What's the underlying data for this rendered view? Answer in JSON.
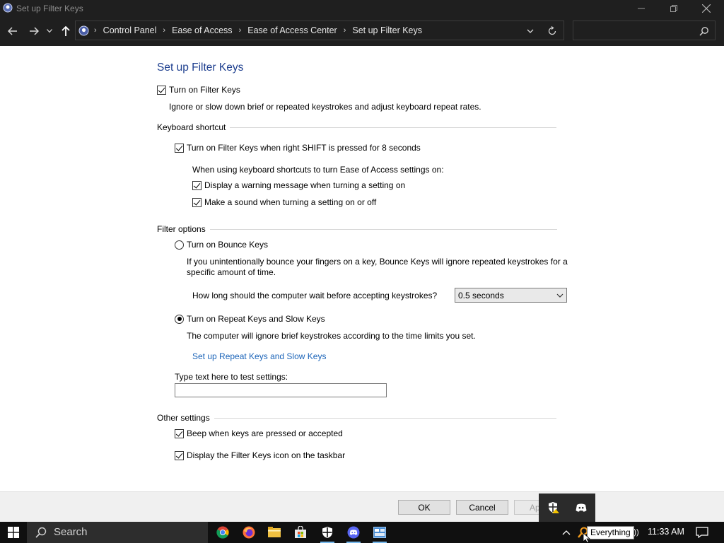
{
  "window": {
    "title": "Set up Filter Keys"
  },
  "address_bar": {
    "breadcrumbs": [
      "Control Panel",
      "Ease of Access",
      "Ease of Access Center",
      "Set up Filter Keys"
    ],
    "search_placeholder": ""
  },
  "page": {
    "heading": "Set up Filter Keys",
    "turn_on_filter_keys": {
      "label": "Turn on Filter Keys",
      "checked": true
    },
    "turn_on_description": "Ignore or slow down brief or repeated keystrokes and adjust keyboard repeat rates.",
    "keyboard_shortcut": {
      "heading": "Keyboard shortcut",
      "shift_option": {
        "label": "Turn on Filter Keys when right SHIFT is pressed for 8 seconds",
        "checked": true
      },
      "note": "When using keyboard shortcuts to turn Ease of Access settings on:",
      "warning_option": {
        "label": "Display a warning message when turning a setting on",
        "checked": true
      },
      "sound_option": {
        "label": "Make a sound when turning a setting on or off",
        "checked": true
      }
    },
    "filter_options": {
      "heading": "Filter options",
      "bounce_keys": {
        "label": "Turn on Bounce Keys",
        "selected": false
      },
      "bounce_description_1": "If you unintentionally bounce your fingers on a key, Bounce Keys will ignore repeated keystrokes for a",
      "bounce_description_2": "specific amount of time.",
      "wait_label": "How long should the computer wait before accepting keystrokes?",
      "wait_value": "0.5 seconds",
      "repeat_keys": {
        "label": "Turn on Repeat Keys and Slow Keys",
        "selected": true
      },
      "repeat_description": "The computer will ignore brief keystrokes according to the time limits you set.",
      "repeat_link": "Set up Repeat Keys and Slow Keys",
      "test_label": "Type text here to test settings:",
      "test_value": ""
    },
    "other_settings": {
      "heading": "Other settings",
      "beep_option": {
        "label": "Beep when keys are pressed or accepted",
        "checked": true
      },
      "icon_option": {
        "label": "Display the Filter Keys icon on the taskbar",
        "checked": true
      }
    }
  },
  "buttons": {
    "ok": "OK",
    "cancel": "Cancel",
    "apply": "Ap"
  },
  "taskbar": {
    "search_label": "Search",
    "clock": "11:33 AM",
    "tooltip": "Everything",
    "volume_glyph": "))"
  },
  "colors": {
    "heading": "#1e3f8f",
    "link": "#1a63b8",
    "chrome": "#1f1f1f",
    "taskbar": "#101010"
  }
}
